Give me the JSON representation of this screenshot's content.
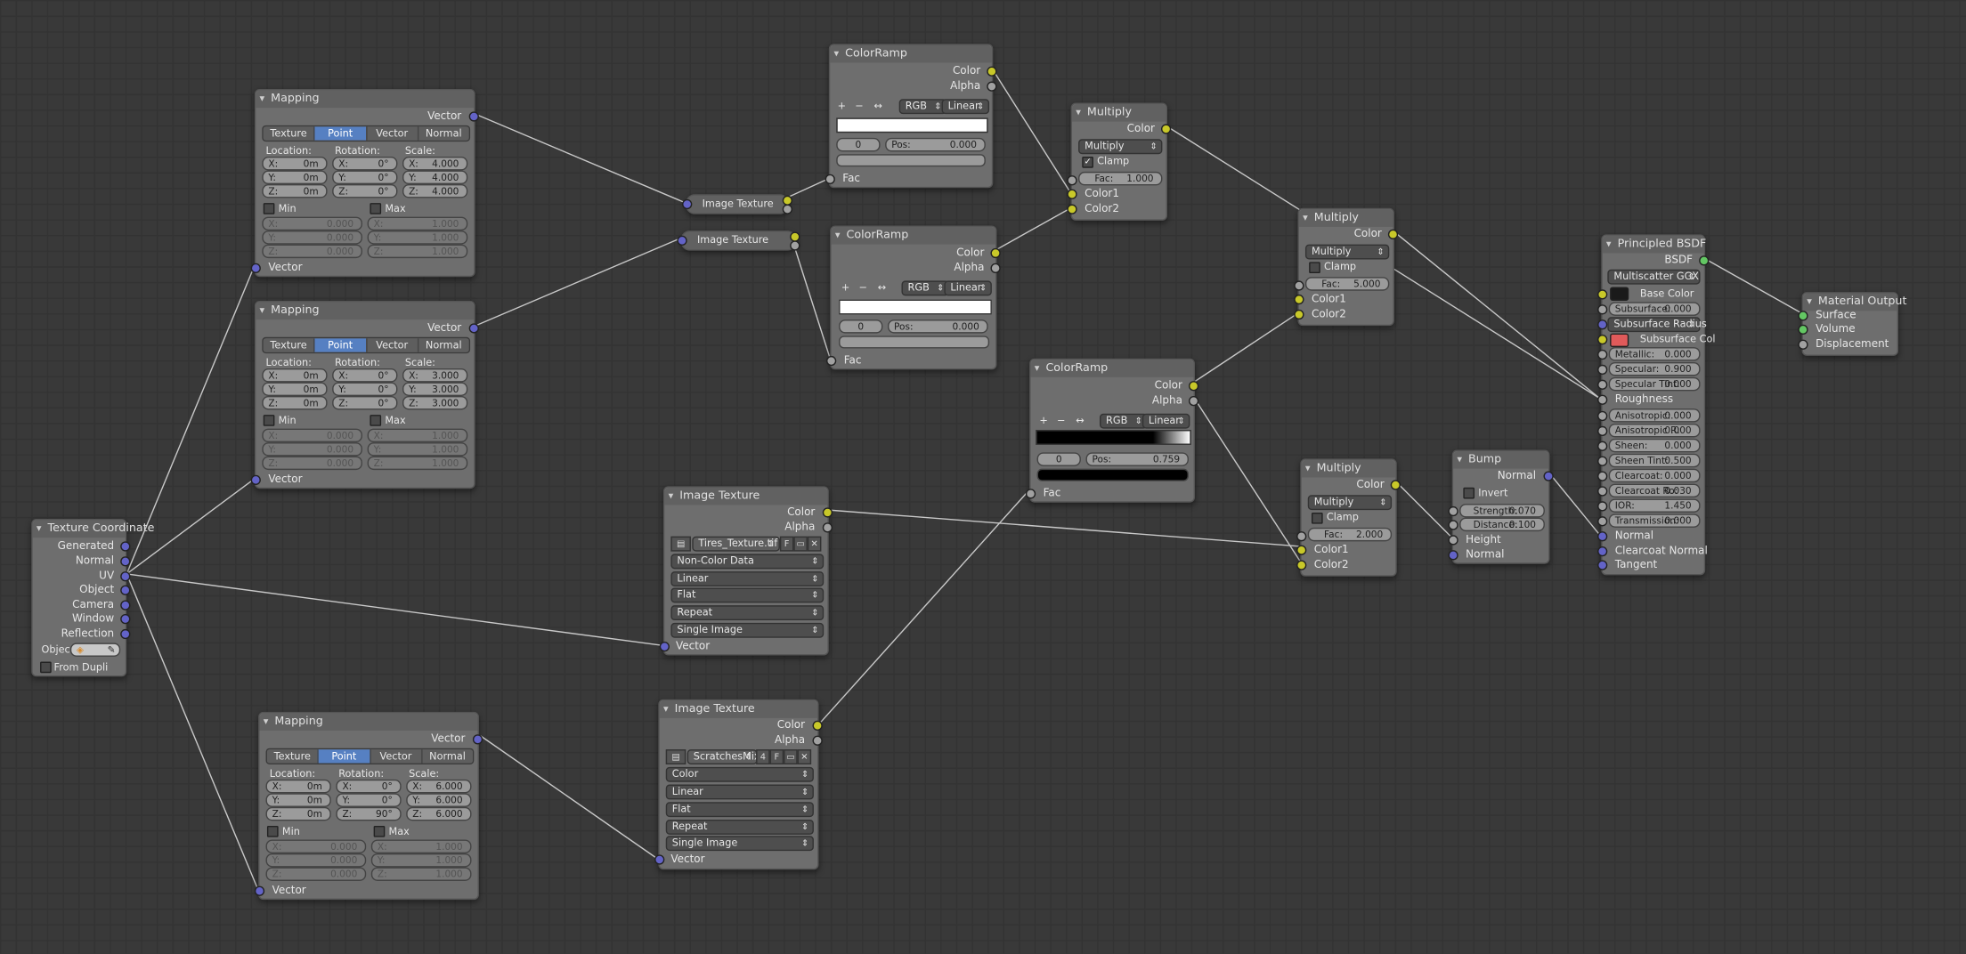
{
  "mapping1": {
    "title": "Mapping",
    "out": "Vector",
    "tabs": [
      "Texture",
      "Point",
      "Vector",
      "Normal"
    ],
    "loc_label": "Location:",
    "rot_label": "Rotation:",
    "scale_label": "Scale:",
    "loc": [
      "X:",
      "0m",
      "Y:",
      "0m",
      "Z:",
      "0m"
    ],
    "rot": [
      "X:",
      "0°",
      "Y:",
      "0°",
      "Z:",
      "0°"
    ],
    "scale": [
      "X:",
      "4.000",
      "Y:",
      "4.000",
      "Z:",
      "4.000"
    ],
    "min": "Min",
    "max": "Max",
    "minv": [
      "X:",
      "0.000",
      "Y:",
      "0.000",
      "Z:",
      "0.000"
    ],
    "maxv": [
      "X:",
      "1.000",
      "Y:",
      "1.000",
      "Z:",
      "1.000"
    ],
    "in": "Vector"
  },
  "mapping2": {
    "title": "Mapping",
    "out": "Vector",
    "tabs": [
      "Texture",
      "Point",
      "Vector",
      "Normal"
    ],
    "loc_label": "Location:",
    "rot_label": "Rotation:",
    "scale_label": "Scale:",
    "loc": [
      "X:",
      "0m",
      "Y:",
      "0m",
      "Z:",
      "0m"
    ],
    "rot": [
      "X:",
      "0°",
      "Y:",
      "0°",
      "Z:",
      "0°"
    ],
    "scale": [
      "X:",
      "3.000",
      "Y:",
      "3.000",
      "Z:",
      "3.000"
    ],
    "min": "Min",
    "max": "Max",
    "minv": [
      "X:",
      "0.000",
      "Y:",
      "0.000",
      "Z:",
      "0.000"
    ],
    "maxv": [
      "X:",
      "1.000",
      "Y:",
      "1.000",
      "Z:",
      "1.000"
    ],
    "in": "Vector"
  },
  "mapping3": {
    "title": "Mapping",
    "out": "Vector",
    "tabs": [
      "Texture",
      "Point",
      "Vector",
      "Normal"
    ],
    "loc_label": "Location:",
    "rot_label": "Rotation:",
    "scale_label": "Scale:",
    "loc": [
      "X:",
      "0m",
      "Y:",
      "0m",
      "Z:",
      "0m"
    ],
    "rot": [
      "X:",
      "0°",
      "Y:",
      "0°",
      "Z:",
      "90°"
    ],
    "scale": [
      "X:",
      "6.000",
      "Y:",
      "6.000",
      "Z:",
      "6.000"
    ],
    "min": "Min",
    "max": "Max",
    "minv": [
      "X:",
      "0.000",
      "Y:",
      "0.000",
      "Z:",
      "0.000"
    ],
    "maxv": [
      "X:",
      "1.000",
      "Y:",
      "1.000",
      "Z:",
      "1.000"
    ],
    "in": "Vector"
  },
  "texcoord": {
    "title": "Texture Coordinate",
    "outs": [
      "Generated",
      "Normal",
      "UV",
      "Object",
      "Camera",
      "Window",
      "Reflection"
    ],
    "object_label": "Objec",
    "from_dupli": "From Dupli"
  },
  "imgtex_small1": {
    "title": "Image Texture"
  },
  "imgtex_small2": {
    "title": "Image Texture"
  },
  "ramp1": {
    "title": "ColorRamp",
    "out1": "Color",
    "out2": "Alpha",
    "mode": "RGB",
    "interp": "Linear",
    "idx": "0",
    "pos_label": "Pos:",
    "pos": "0.000",
    "in": "Fac"
  },
  "ramp2": {
    "title": "ColorRamp",
    "out1": "Color",
    "out2": "Alpha",
    "mode": "RGB",
    "interp": "Linear",
    "idx": "0",
    "pos_label": "Pos:",
    "pos": "0.000",
    "in": "Fac"
  },
  "ramp3": {
    "title": "ColorRamp",
    "out1": "Color",
    "out2": "Alpha",
    "mode": "RGB",
    "interp": "Linear",
    "idx": "0",
    "pos_label": "Pos:",
    "pos": "0.759",
    "in": "Fac"
  },
  "ramp_tools": [
    "+",
    "−",
    "↔"
  ],
  "mult1": {
    "title": "Multiply",
    "out": "Color",
    "op": "Multiply",
    "clamp": "Clamp",
    "fac_label": "Fac:",
    "fac": "1.000",
    "in1": "Color1",
    "in2": "Color2"
  },
  "mult2": {
    "title": "Multiply",
    "out": "Color",
    "op": "Multiply",
    "clamp": "Clamp",
    "fac_label": "Fac:",
    "fac": "5.000",
    "in1": "Color1",
    "in2": "Color2"
  },
  "mult3": {
    "title": "Multiply",
    "out": "Color",
    "op": "Multiply",
    "clamp": "Clamp",
    "fac_label": "Fac:",
    "fac": "2.000",
    "in1": "Color1",
    "in2": "Color2"
  },
  "img1": {
    "title": "Image Texture",
    "out1": "Color",
    "out2": "Alpha",
    "file": "Tires_Texture.tif",
    "f": "F",
    "opts": [
      "Non-Color Data",
      "Linear",
      "Flat",
      "Repeat",
      "Single Image"
    ],
    "in": "Vector"
  },
  "img2": {
    "title": "Image Texture",
    "out1": "Color",
    "out2": "Alpha",
    "file": "ScratchesMixe...",
    "users": "4",
    "f": "F",
    "opts": [
      "Color",
      "Linear",
      "Flat",
      "Repeat",
      "Single Image"
    ],
    "in": "Vector"
  },
  "bump": {
    "title": "Bump",
    "out": "Normal",
    "invert": "Invert",
    "strength_label": "Strength:",
    "strength": "0.070",
    "distance_label": "Distance:",
    "distance": "0.100",
    "in1": "Height",
    "in2": "Normal"
  },
  "bsdf": {
    "title": "Principled BSDF",
    "out": "BSDF",
    "dist": "Multiscatter GGX",
    "base": "Base Color",
    "subsurface_label": "Subsurface:",
    "subsurface": "0.000",
    "ss_radius": "Subsurface Radius",
    "ss_col": "Subsurface Col",
    "fields": [
      [
        "Metallic:",
        "0.000"
      ],
      [
        "Specular:",
        "0.900"
      ],
      [
        "Specular Tint:",
        "0.000"
      ]
    ],
    "roughness": "Roughness",
    "fields2": [
      [
        "Anisotropic:",
        "0.000"
      ],
      [
        "Anisotropic R:",
        "0.000"
      ],
      [
        "Sheen:",
        "0.000"
      ],
      [
        "Sheen Tint:",
        "0.500"
      ],
      [
        "Clearcoat:",
        "0.000"
      ],
      [
        "Clearcoat Ro:",
        "0.030"
      ],
      [
        "IOR:",
        "1.450"
      ],
      [
        "Transmission:",
        "0.000"
      ]
    ],
    "ins": [
      "Normal",
      "Clearcoat Normal",
      "Tangent"
    ]
  },
  "output": {
    "title": "Material Output",
    "ins": [
      "Surface",
      "Volume",
      "Displacement"
    ]
  },
  "colors": {
    "accent": "#5680c2",
    "socket_color": "#c8c829",
    "socket_float": "#a1a1a1",
    "socket_vector": "#6363c7",
    "socket_shader": "#63c763",
    "ss_col": "#e05a5a",
    "base_col": "#1a1a1a"
  }
}
